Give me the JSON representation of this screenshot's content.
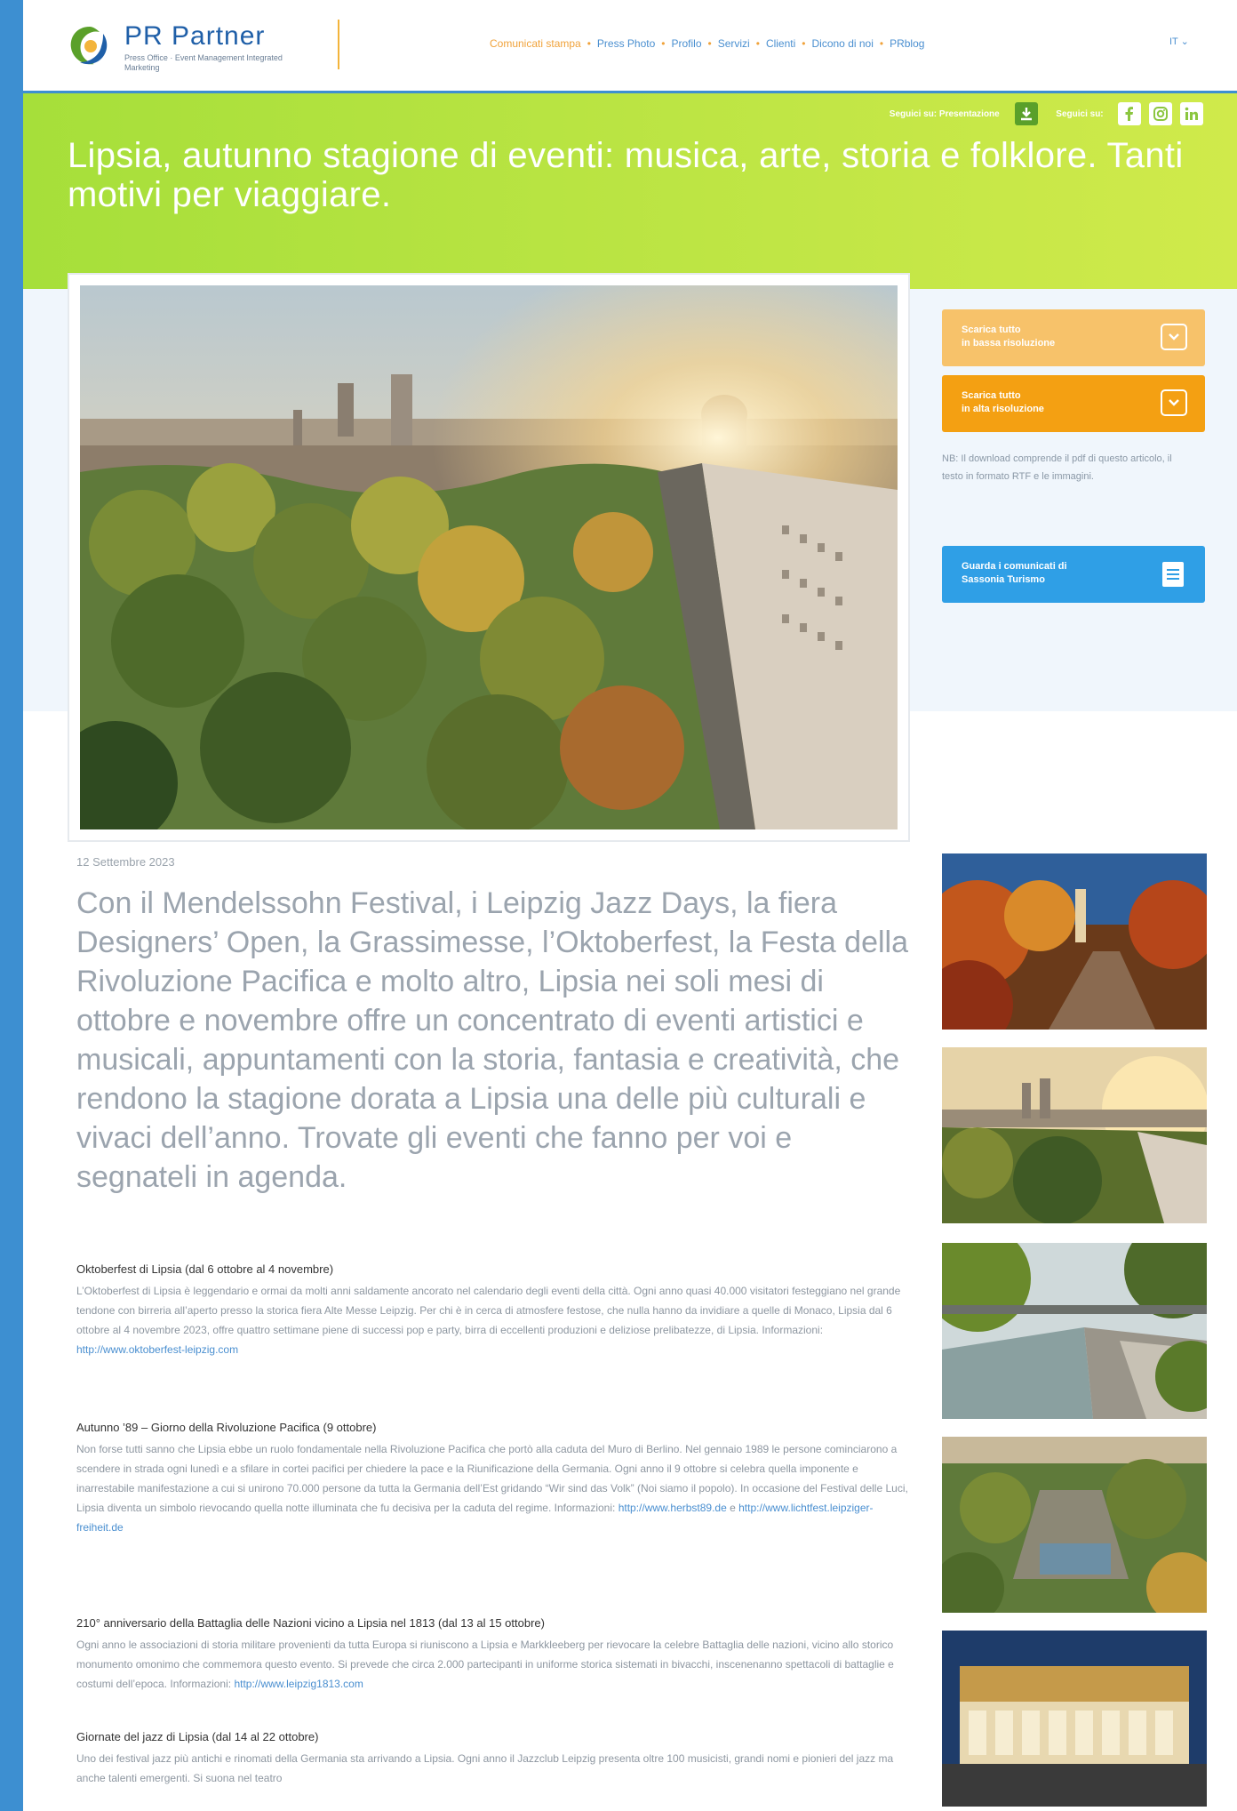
{
  "header": {
    "brand": "PR Partner",
    "tagline": "Press Office · Event Management Integrated Marketing",
    "nav": [
      "Comunicati stampa",
      "Press Photo",
      "Profilo",
      "Servizi",
      "Clienti",
      "Dicono di noi",
      "PRblog"
    ],
    "lang": "IT"
  },
  "hero": {
    "follow_presentation": "Seguici su: Presentazione",
    "follow_social": "Seguici su:",
    "title": "Lipsia, autunno stagione di eventi: musica, arte, storia e folklore. Tanti motivi per viaggiare."
  },
  "sidebar": {
    "download_low": [
      "Scarica tutto",
      "in bassa risoluzione"
    ],
    "download_high": [
      "Scarica tutto",
      "in alta risoluzione"
    ],
    "download_note": "NB: Il download comprende il pdf di questo articolo, il testo in formato RTF e le immagini.",
    "view_releases": [
      "Guarda i comunicati di",
      "Sassonia Turismo"
    ]
  },
  "article": {
    "date": "12 Settembre 2023",
    "lead": "Con il Mendelssohn Festival, i Leipzig Jazz Days, la fiera Designers’ Open, la Grassimesse, l’Oktoberfest, la Festa della Rivoluzione Pacifica e molto altro, Lipsia nei soli mesi di ottobre e novembre offre un concentrato di eventi artistici e musicali, appuntamenti con la storia, fantasia e creatività, che rendono la stagione dorata a Lipsia una delle più culturali e vivaci dell’anno. Trovate gli eventi che fanno per voi e segnateli in agenda.",
    "sections": [
      {
        "heading": "Oktoberfest di Lipsia (dal 6 ottobre al 4 novembre)",
        "body": "L’Oktoberfest di Lipsia è leggendario e ormai da molti anni saldamente ancorato nel calendario degli eventi della città. Ogni anno quasi 40.000 visitatori festeggiano nel grande tendone con birreria all’aperto presso la storica fiera Alte Messe Leipzig. Per chi è in cerca di atmosfere festose, che nulla hanno da invidiare a quelle di Monaco, Lipsia dal 6 ottobre al 4 novembre 2023, offre quattro settimane piene di successi pop e party, birra di eccellenti produzioni e deliziose prelibatezze, di Lipsia. Informazioni:",
        "links": [
          "http://www.oktoberfest-leipzig.com"
        ]
      },
      {
        "heading": "Autunno ’89 – Giorno della Rivoluzione Pacifica (9 ottobre)",
        "body": "Non forse tutti sanno che Lipsia ebbe un ruolo fondamentale nella Rivoluzione Pacifica che portò alla caduta del Muro di Berlino. Nel gennaio 1989 le persone cominciarono a scendere in strada ogni lunedì e a sfilare in cortei pacifici per chiedere la pace e la Riunificazione della Germania. Ogni anno il 9 ottobre si celebra quella imponente e inarrestabile manifestazione a cui si unirono 70.000 persone da tutta la Germania dell’Est gridando “Wir sind das Volk” (Noi siamo il popolo). In occasione del Festival delle Luci, Lipsia diventa un simbolo rievocando quella notte illuminata che fu decisiva per la caduta del regime. Informazioni:",
        "links": [
          "http://www.herbst89.de",
          "http://www.lichtfest.leipziger-freiheit.de"
        ]
      },
      {
        "heading": "210° anniversario della Battaglia delle Nazioni vicino a Lipsia nel 1813 (dal 13 al 15 ottobre)",
        "body": "Ogni anno le associazioni di storia militare provenienti da tutta Europa si riuniscono a Lipsia e Markkleeberg per rievocare la celebre Battaglia delle nazioni, vicino allo storico monumento omonimo che commemora questo evento. Si prevede che circa 2.000 partecipanti in uniforme storica sistemati in bivacchi, inscenenanno spettacoli di battaglie e costumi dell’epoca. Informazioni:",
        "links": [
          "http://www.leipzig1813.com"
        ]
      },
      {
        "heading": "Giornate del jazz di Lipsia (dal 14 al 22 ottobre)",
        "body": "Uno dei festival jazz più antichi e rinomati della Germania sta arrivando a Lipsia. Ogni anno il Jazzclub Leipzig presenta oltre 100 musicisti, grandi nomi e pionieri del jazz ma anche talenti emergenti. Si suona nel teatro",
        "links": []
      }
    ]
  },
  "colors": {
    "frame_blue": "#3d8fd1",
    "band_green": "#b4e23f",
    "accent_orange": "#f4a012",
    "button_blue": "#2f9fe6"
  }
}
